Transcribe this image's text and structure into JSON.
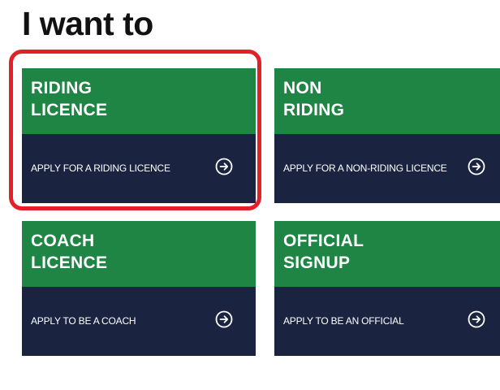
{
  "page": {
    "heading": "I want to"
  },
  "cards": [
    {
      "title_line1": "RIDING",
      "title_line2": "LICENCE",
      "action": "APPLY FOR A RIDING LICENCE",
      "icon": "arrow-circle-right-icon"
    },
    {
      "title_line1": "NON",
      "title_line2": "RIDING",
      "action": "APPLY FOR A NON-RIDING LICENCE",
      "icon": "arrow-circle-right-icon"
    },
    {
      "title_line1": "COACH",
      "title_line2": "LICENCE",
      "action": "APPLY TO BE A COACH",
      "icon": "arrow-circle-right-icon"
    },
    {
      "title_line1": "OFFICIAL",
      "title_line2": "SIGNUP",
      "action": "APPLY TO BE AN OFFICIAL",
      "icon": "arrow-circle-right-icon"
    }
  ],
  "colors": {
    "card_top": "#1e8545",
    "card_bottom": "#1a2441",
    "highlight": "#e32027",
    "text": "#ffffff"
  }
}
